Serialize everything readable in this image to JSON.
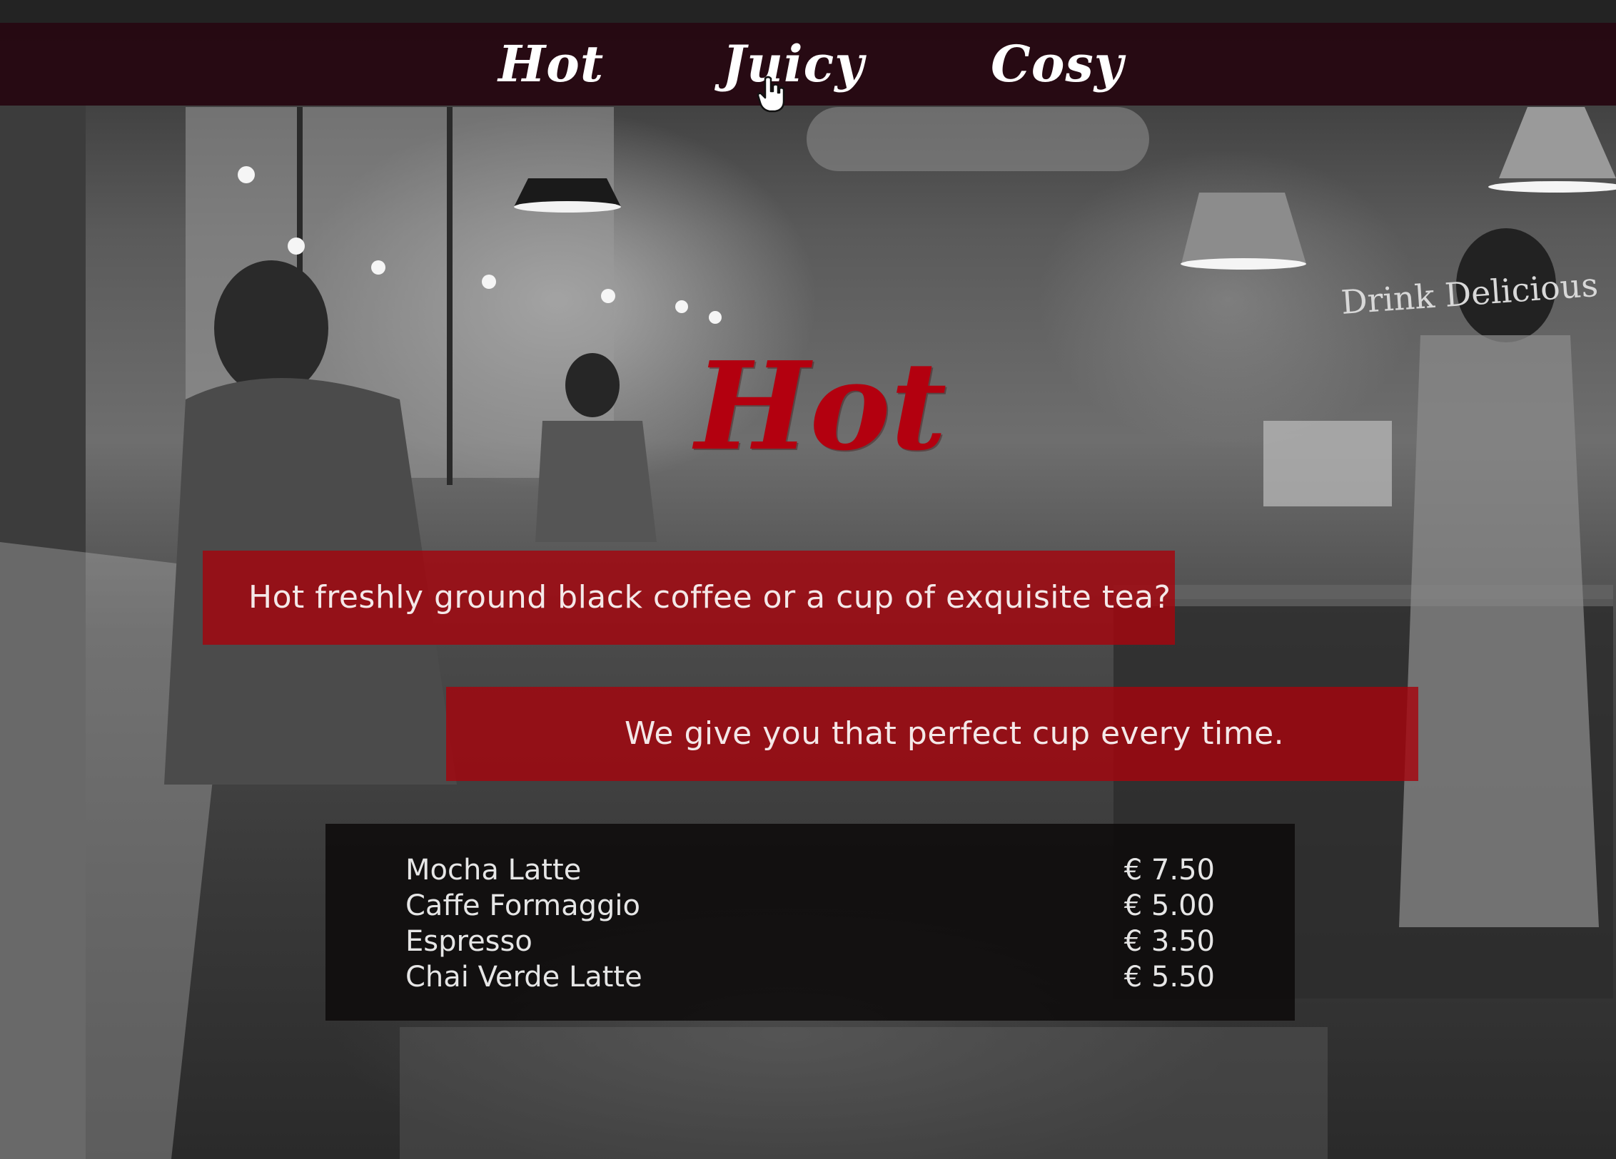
{
  "nav": {
    "items": [
      {
        "label": "Hot"
      },
      {
        "label": "Juicy"
      },
      {
        "label": "Cosy"
      }
    ],
    "hovered": "Juicy",
    "cursor_icon": "pointer-hand-icon"
  },
  "hero": {
    "title": "Hot",
    "title_color": "#b3000f"
  },
  "taglines": {
    "line1": "Hot freshly ground black coffee or a cup of exquisite tea?",
    "line2": "We give you that perfect cup every time."
  },
  "menu": {
    "items": [
      {
        "name": "Mocha Latte",
        "price": "€ 7.50"
      },
      {
        "name": "Caffe Formaggio",
        "price": "€ 5.00"
      },
      {
        "name": "Espresso",
        "price": "€ 3.50"
      },
      {
        "name": "Chai Verde Latte",
        "price": "€ 5.50"
      }
    ]
  },
  "background": {
    "sign_text": "Drink Delicious"
  },
  "colors": {
    "accent_red": "#a5050e",
    "navbar": "#260610",
    "menu_board": "#0e0c0c"
  }
}
